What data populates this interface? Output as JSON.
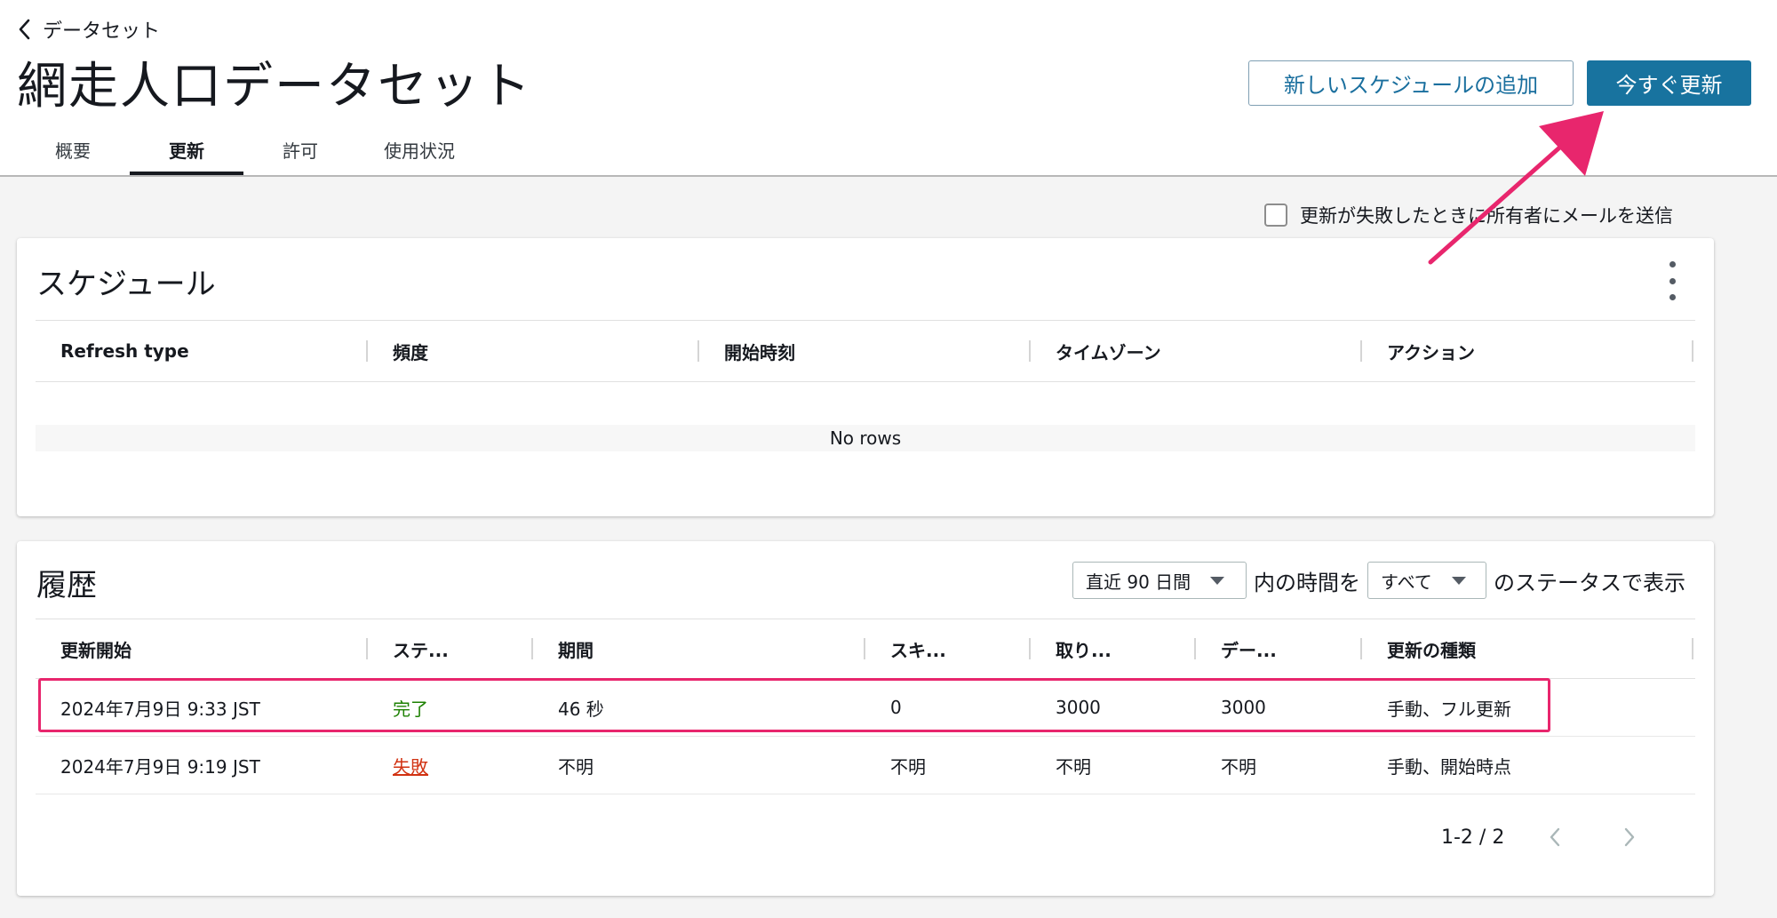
{
  "back_link": "データセット",
  "page_title": "網走人口データセット",
  "actions": {
    "add_schedule": "新しいスケジュールの追加",
    "refresh_now": "今すぐ更新"
  },
  "tabs": [
    {
      "label": "概要"
    },
    {
      "label": "更新"
    },
    {
      "label": "許可"
    },
    {
      "label": "使用状況"
    }
  ],
  "active_tab": "更新",
  "email_option_label": "更新が失敗したときに所有者にメールを送信",
  "schedule": {
    "title": "スケジュール",
    "columns": [
      "Refresh type",
      "頻度",
      "開始時刻",
      "タイムゾーン",
      "アクション"
    ],
    "empty_text": "No rows"
  },
  "history": {
    "title": "履歴",
    "filter": {
      "period": "直近 90 日間",
      "between_text": "内の時間を",
      "status": "すべて",
      "after_text": "のステータスで表示"
    },
    "columns": [
      "更新開始",
      "ステ...",
      "期間",
      "スキ...",
      "取り...",
      "デー...",
      "更新の種類"
    ],
    "rows": [
      {
        "start": "2024年7月9日 9:33 JST",
        "status": "完了",
        "duration": "46 秒",
        "skipped": "0",
        "ingested": "3000",
        "dataset": "3000",
        "type": "手動、フル更新"
      },
      {
        "start": "2024年7月9日 9:19 JST",
        "status": "失敗",
        "duration": "不明",
        "skipped": "不明",
        "ingested": "不明",
        "dataset": "不明",
        "type": "手動、開始時点"
      }
    ],
    "pagination": "1-2 / 2"
  },
  "colors": {
    "primary": "#18739f",
    "success": "#1d8102",
    "error": "#d13212",
    "annotation": "#e8266d"
  }
}
